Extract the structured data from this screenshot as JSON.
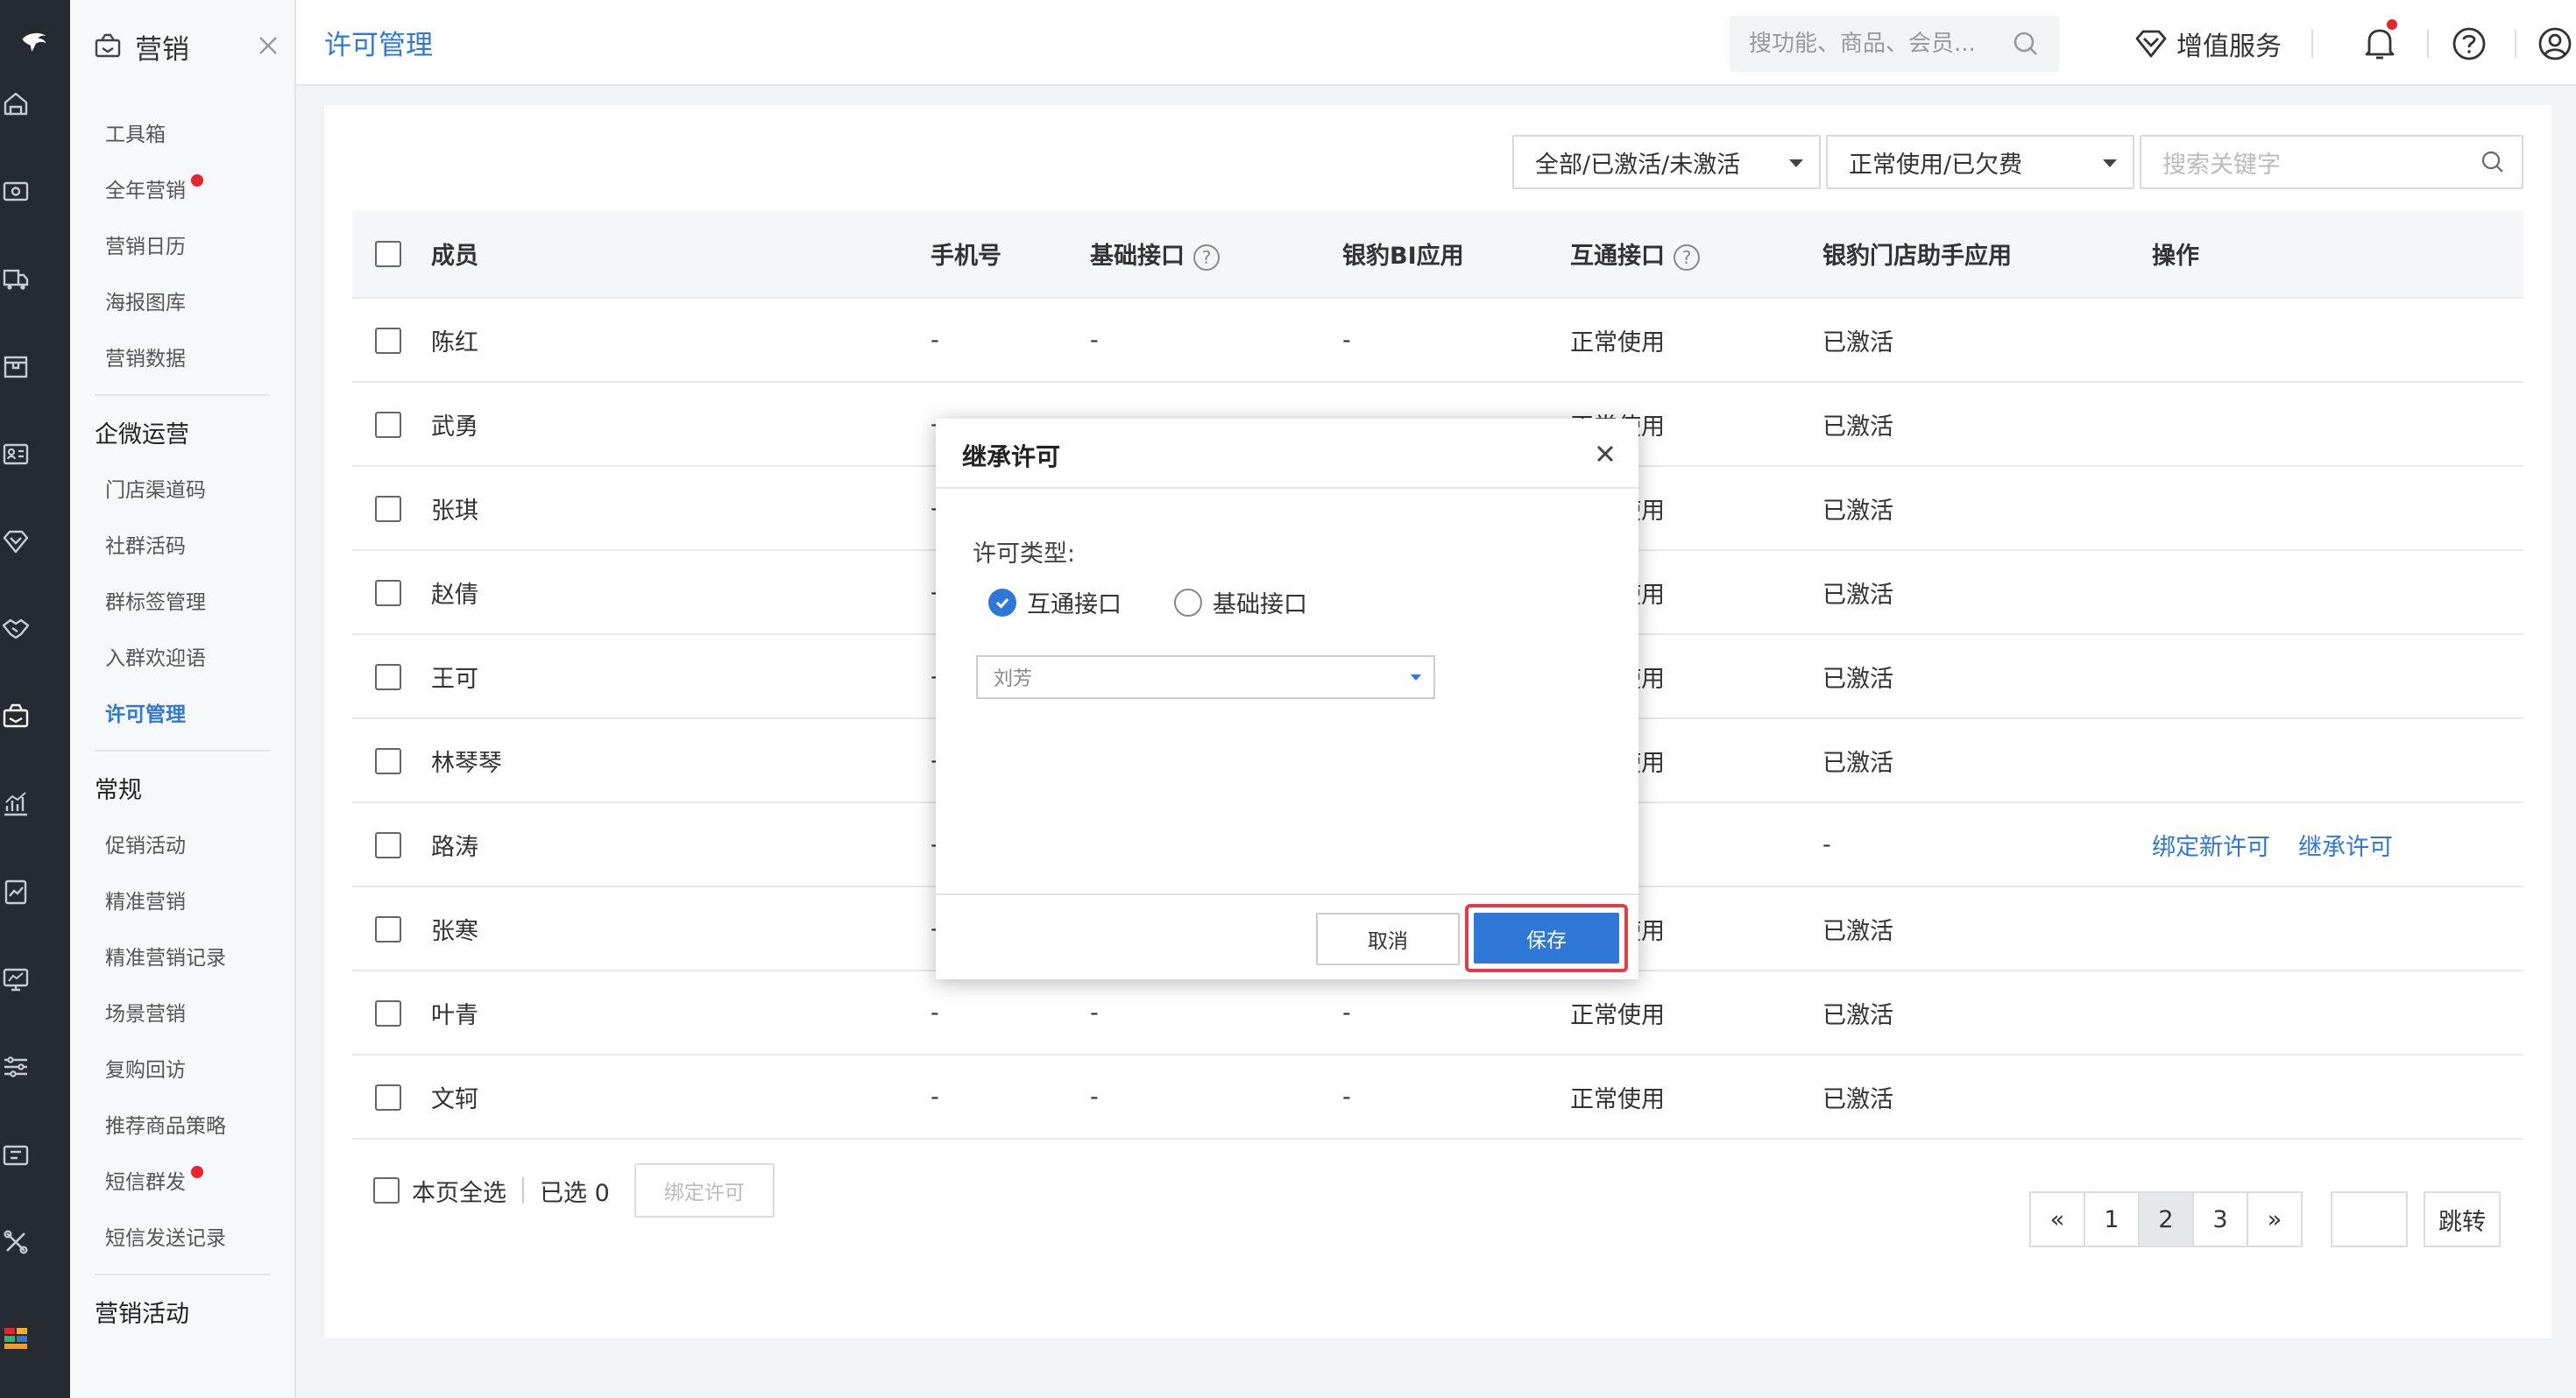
{
  "rail": {
    "items": [
      "home-icon",
      "money-icon",
      "truck-icon",
      "box-icon",
      "id-card-icon",
      "diamond-icon",
      "handshake-icon",
      "marketing-icon",
      "chart-icon",
      "report-icon",
      "monitor-icon",
      "sliders-icon",
      "ticket-icon",
      "tools-icon",
      "apps-icon"
    ]
  },
  "sidebar": {
    "title": "营销",
    "items_top": [
      {
        "label": "工具箱",
        "dot": false
      },
      {
        "label": "全年营销",
        "dot": true
      },
      {
        "label": "营销日历",
        "dot": false
      },
      {
        "label": "海报图库",
        "dot": false
      },
      {
        "label": "营销数据",
        "dot": false
      }
    ],
    "group1": "企微运营",
    "items_g1": [
      {
        "label": "门店渠道码"
      },
      {
        "label": "社群活码"
      },
      {
        "label": "群标签管理"
      },
      {
        "label": "入群欢迎语"
      },
      {
        "label": "许可管理",
        "active": true
      }
    ],
    "group2": "常规",
    "items_g2": [
      {
        "label": "促销活动",
        "dot": false
      },
      {
        "label": "精准营销",
        "dot": false
      },
      {
        "label": "精准营销记录",
        "dot": false
      },
      {
        "label": "场景营销",
        "dot": false
      },
      {
        "label": "复购回访",
        "dot": false
      },
      {
        "label": "推荐商品策略",
        "dot": false
      },
      {
        "label": "短信群发",
        "dot": true
      },
      {
        "label": "短信发送记录",
        "dot": false
      }
    ],
    "group3": "营销活动"
  },
  "header": {
    "page_title": "许可管理",
    "search_placeholder": "搜功能、商品、会员...",
    "value_service": "增值服务"
  },
  "filters": {
    "activation": "全部/已激活/未激活",
    "usage": "正常使用/已欠费",
    "keyword_placeholder": "搜索关键字"
  },
  "table": {
    "columns": [
      "成员",
      "手机号",
      "基础接口",
      "银豹BI应用",
      "互通接口",
      "银豹门店助手应用",
      "操作"
    ],
    "rows": [
      {
        "member": "陈红",
        "phone": "-",
        "basic": "-",
        "bi": "-",
        "interop": "正常使用",
        "assistant": "已激活",
        "ops": []
      },
      {
        "member": "武勇",
        "phone": "-",
        "basic": "-",
        "bi": "-",
        "interop": "正常使用",
        "assistant": "已激活",
        "ops": []
      },
      {
        "member": "张琪",
        "phone": "-",
        "basic": "-",
        "bi": "-",
        "interop": "正常使用",
        "assistant": "已激活",
        "ops": []
      },
      {
        "member": "赵倩",
        "phone": "-",
        "basic": "-",
        "bi": "-",
        "interop": "正常使用",
        "assistant": "已激活",
        "ops": []
      },
      {
        "member": "王可",
        "phone": "-",
        "basic": "-",
        "bi": "-",
        "interop": "正常使用",
        "assistant": "已激活",
        "ops": []
      },
      {
        "member": "林琴琴",
        "phone": "-",
        "basic": "-",
        "bi": "-",
        "interop": "正常使用",
        "assistant": "已激活",
        "ops": []
      },
      {
        "member": "路涛",
        "phone": "-",
        "basic": "-",
        "bi": "-",
        "interop": "-",
        "assistant": "-",
        "ops": [
          "绑定新许可",
          "继承许可"
        ]
      },
      {
        "member": "张寒",
        "phone": "-",
        "basic": "-",
        "bi": "-",
        "interop": "正常使用",
        "assistant": "已激活",
        "ops": []
      },
      {
        "member": "叶青",
        "phone": "-",
        "basic": "-",
        "bi": "-",
        "interop": "正常使用",
        "assistant": "已激活",
        "ops": []
      },
      {
        "member": "文轲",
        "phone": "-",
        "basic": "-",
        "bi": "-",
        "interop": "正常使用",
        "assistant": "已激活",
        "ops": []
      }
    ]
  },
  "footer": {
    "select_all": "本页全选",
    "selected": "已选 0",
    "bind_license": "绑定许可"
  },
  "pager": {
    "prev": "«",
    "pages": [
      "1",
      "2",
      "3"
    ],
    "current": "2",
    "next": "»",
    "jump": "跳转"
  },
  "modal": {
    "title": "继承许可",
    "type_label": "许可类型:",
    "options": [
      {
        "label": "互通接口",
        "checked": true
      },
      {
        "label": "基础接口",
        "checked": false
      }
    ],
    "selected_member": "刘芳",
    "cancel": "取消",
    "save": "保存"
  },
  "colors": {
    "accent": "#2f78d8",
    "rail": "#262a31",
    "alert": "#e8242f",
    "highlight": "#e23b4a"
  }
}
